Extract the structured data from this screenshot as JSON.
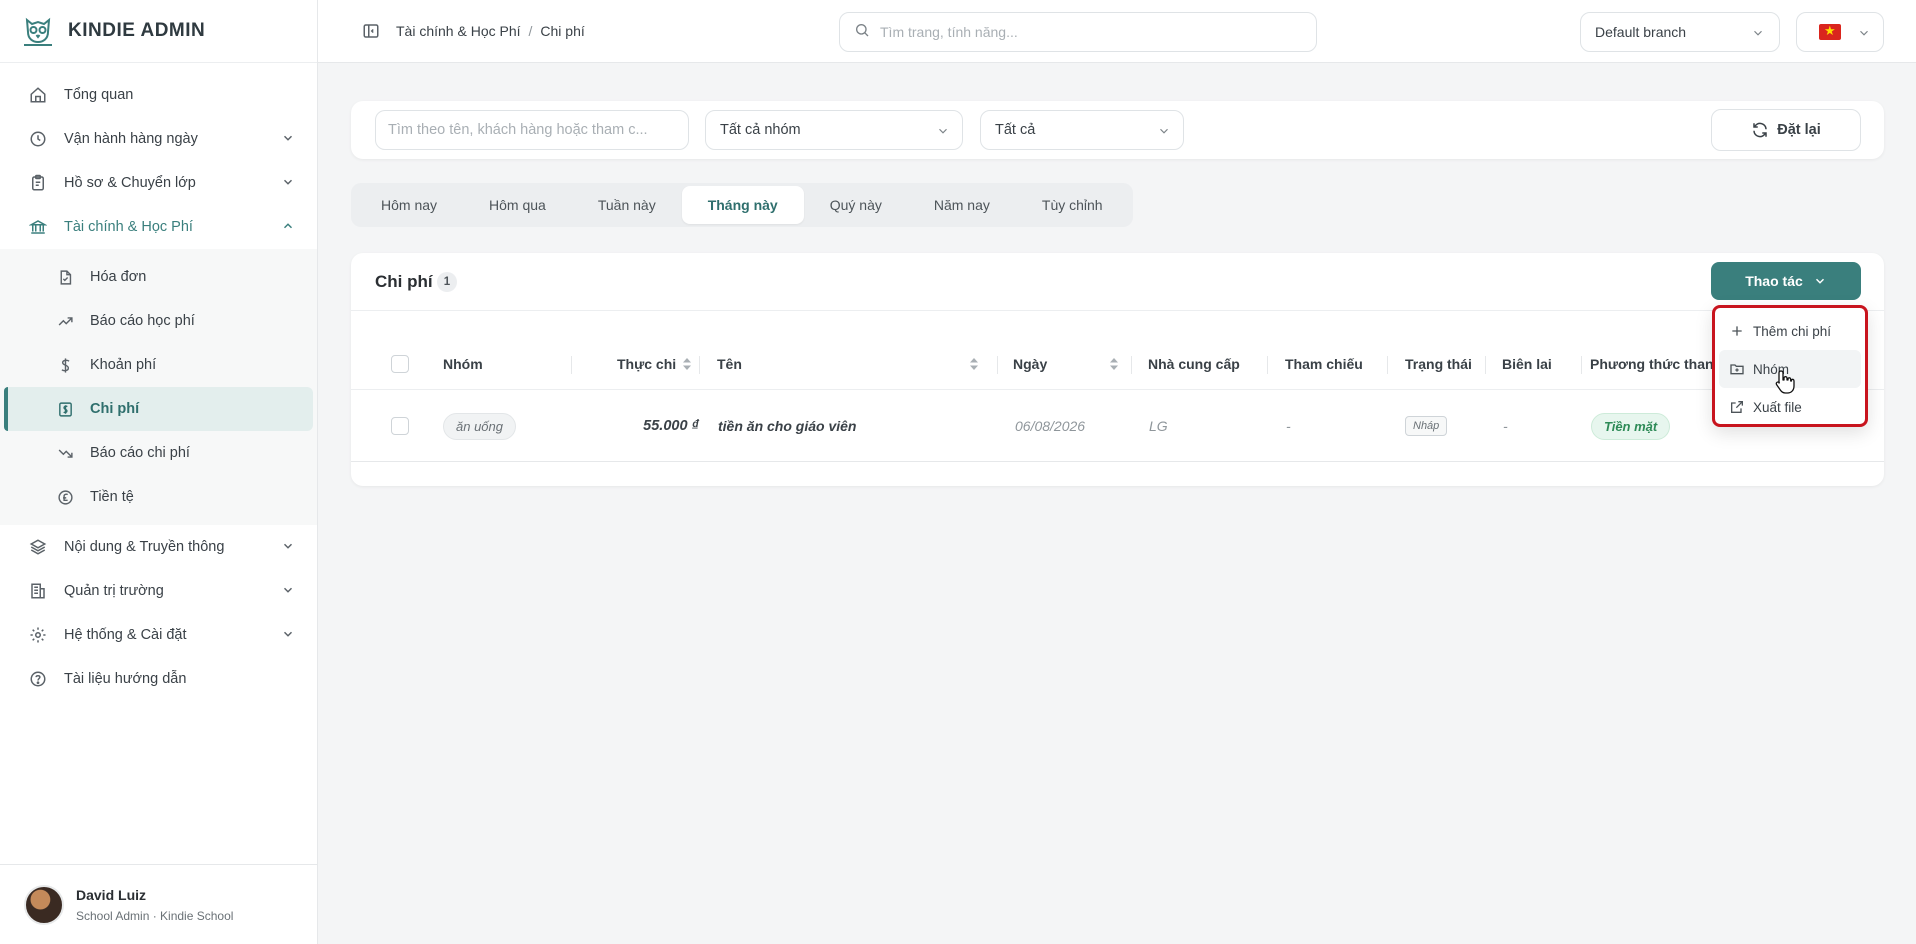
{
  "brand": {
    "name": "KINDIE ADMIN"
  },
  "sidebar": {
    "items": [
      {
        "label": "Tổng quan",
        "icon": "home-icon"
      },
      {
        "label": "Vận hành hàng ngày",
        "icon": "clock-icon"
      },
      {
        "label": "Hồ sơ & Chuyển lớp",
        "icon": "clipboard-icon"
      },
      {
        "label": "Tài chính & Học Phí",
        "icon": "bank-icon"
      },
      {
        "label": "Nội dung & Truyền thông",
        "icon": "layers-icon"
      },
      {
        "label": "Quản trị trường",
        "icon": "building-icon"
      },
      {
        "label": "Hệ thống & Cài đặt",
        "icon": "gear-icon"
      },
      {
        "label": "Tài liệu hướng dẫn",
        "icon": "help-circle-icon"
      }
    ],
    "finance_sub": [
      {
        "label": "Hóa đơn",
        "icon": "invoice-icon"
      },
      {
        "label": "Báo cáo học phí",
        "icon": "trend-up-icon"
      },
      {
        "label": "Khoản phí",
        "icon": "dollar-icon"
      },
      {
        "label": "Chi phí",
        "icon": "expense-icon"
      },
      {
        "label": "Báo cáo chi phí",
        "icon": "trend-down-icon"
      },
      {
        "label": "Tiền tệ",
        "icon": "currency-icon"
      }
    ]
  },
  "user": {
    "name": "David Luiz",
    "role": "School Admin · Kindie School"
  },
  "topbar": {
    "breadcrumb": [
      "Tài chính & Học Phí",
      "Chi phí"
    ],
    "search_placeholder": "Tìm trang, tính năng...",
    "branch": "Default branch"
  },
  "filters": {
    "search_placeholder": "Tìm theo tên, khách hàng hoặc tham c...",
    "group_select": "Tất cả nhóm",
    "status_select": "Tất cả",
    "reset_label": "Đặt lại"
  },
  "tabs": [
    "Hôm nay",
    "Hôm qua",
    "Tuần này",
    "Tháng này",
    "Quý này",
    "Năm nay",
    "Tùy chỉnh"
  ],
  "table": {
    "title": "Chi phí",
    "count": "1",
    "action_label": "Thao tác",
    "columns": [
      "Nhóm",
      "Thực chi",
      "Tên",
      "Ngày",
      "Nhà cung cấp",
      "Tham chiếu",
      "Trạng thái",
      "Biên lai",
      "Phương thức thanh"
    ],
    "rows": [
      {
        "group": "ăn uống",
        "amount": "55.000 ₫",
        "name": "tiền ăn cho giáo viên",
        "date": "06/08/2026",
        "vendor": "LG",
        "reference": "-",
        "status": "Nháp",
        "receipt": "-",
        "payment": "Tiền mặt"
      }
    ]
  },
  "dropdown": {
    "items": [
      {
        "label": "Thêm chi phí",
        "icon": "plus-icon"
      },
      {
        "label": "Nhóm",
        "icon": "folder-plus-icon"
      },
      {
        "label": "Xuất file",
        "icon": "external-link-icon"
      }
    ]
  },
  "colors": {
    "accent": "#3a7f7d",
    "highlight": "#c8141e"
  }
}
